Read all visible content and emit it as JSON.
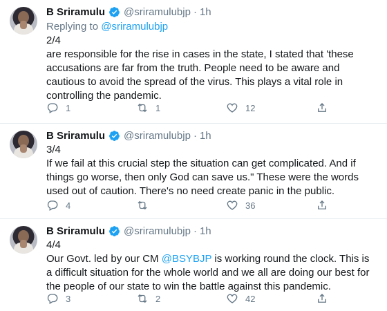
{
  "tweets": [
    {
      "name": "B Sriramulu",
      "handle": "@sriramulubjp",
      "separator": "·",
      "time": "1h",
      "replying_prefix": "Replying to ",
      "replying_handle": "@sriramulubjp",
      "counter": "2/4",
      "text": "are responsible for the rise in cases in the state, I stated that 'these accusations are far from the truth. People need to be aware and cautious to avoid the spread of the virus. This plays a vital role in controlling the pandemic.",
      "replies": "1",
      "retweets": "1",
      "likes": "12"
    },
    {
      "name": "B Sriramulu",
      "handle": "@sriramulubjp",
      "separator": "·",
      "time": "1h",
      "counter": "3/4",
      "text": "If we fail at this crucial step the situation can get complicated. And if things go worse, then only God can save us.\" These were the words used out of caution. There's no need create panic in the public.",
      "replies": "4",
      "retweets": "",
      "likes": "36"
    },
    {
      "name": "B Sriramulu",
      "handle": "@sriramulubjp",
      "separator": "·",
      "time": "1h",
      "counter": "4/4",
      "text_before": "Our Govt. led by our CM ",
      "text_mention": "@BSYBJP",
      "text_after": " is working round the clock. This is a difficult situation for the whole world and we all are doing our best for the people of our state to win the battle against this pandemic.",
      "replies": "3",
      "retweets": "2",
      "likes": "42"
    }
  ],
  "colors": {
    "accent": "#1da1f2",
    "muted": "#657786",
    "text": "#14171a",
    "divider": "#e6ecf0"
  },
  "icons": [
    "reply-icon",
    "retweet-icon",
    "like-icon",
    "share-icon",
    "verified-badge-icon"
  ]
}
